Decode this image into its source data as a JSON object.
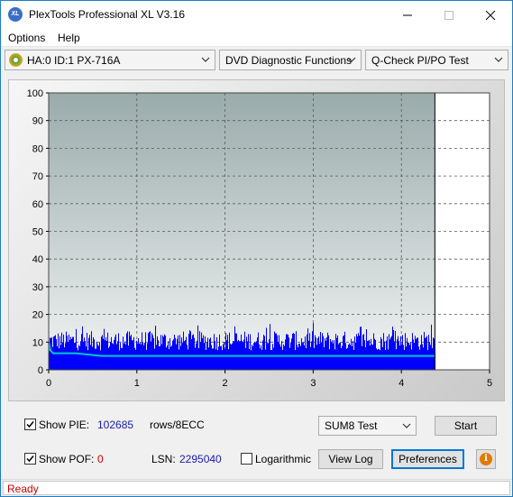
{
  "window": {
    "title": "PlexTools Professional XL V3.16",
    "app_icon_text": "XL"
  },
  "menu": {
    "items": [
      "Options",
      "Help"
    ]
  },
  "toolbar": {
    "drive": "HA:0 ID:1  PX-716A",
    "function": "DVD Diagnostic Functions",
    "test": "Q-Check PI/PO Test"
  },
  "chart_data": {
    "type": "bar",
    "title": "",
    "xlabel": "",
    "ylabel": "",
    "xlim": [
      0,
      5
    ],
    "ylim": [
      0,
      100
    ],
    "x_ticks": [
      "0",
      "1",
      "2",
      "3",
      "4",
      "5"
    ],
    "y_ticks": [
      "0",
      "10",
      "20",
      "30",
      "40",
      "50",
      "60",
      "70",
      "80",
      "90",
      "100"
    ],
    "data_end_x": 4.38,
    "grid": true,
    "series": [
      {
        "color": "#0000ff",
        "style": "bars",
        "typical_range": [
          7,
          14
        ],
        "peak": 17
      },
      {
        "color": "#00c8c8",
        "style": "line",
        "points": [
          [
            0.0,
            10
          ],
          [
            0.02,
            7
          ],
          [
            0.05,
            6
          ],
          [
            0.1,
            6
          ],
          [
            0.3,
            6
          ],
          [
            0.6,
            5
          ],
          [
            1.0,
            5
          ],
          [
            1.5,
            5
          ],
          [
            2.0,
            5
          ],
          [
            2.5,
            5
          ],
          [
            3.0,
            5
          ],
          [
            3.5,
            5
          ],
          [
            4.0,
            5
          ],
          [
            4.38,
            5
          ]
        ]
      }
    ],
    "colors": {
      "plot_bg_top": "#9aabab",
      "plot_bg_bottom": "#f2f4f4",
      "unused_area": "#ffffff"
    }
  },
  "controls": {
    "show_pie_label": "Show PIE:",
    "show_pie_checked": true,
    "pie_value": "102685",
    "pie_unit": "rows/8ECC",
    "show_pof_label": "Show POF:",
    "show_pof_checked": true,
    "pof_value": "0",
    "lsn_label": "LSN:",
    "lsn_value": "2295040",
    "logarithmic_label": "Logarithmic",
    "logarithmic_checked": false,
    "test_select": "SUM8 Test",
    "start_label": "Start",
    "view_log_label": "View Log",
    "preferences_label": "Preferences",
    "info_icon": "info-icon"
  },
  "status": {
    "text": "Ready"
  }
}
